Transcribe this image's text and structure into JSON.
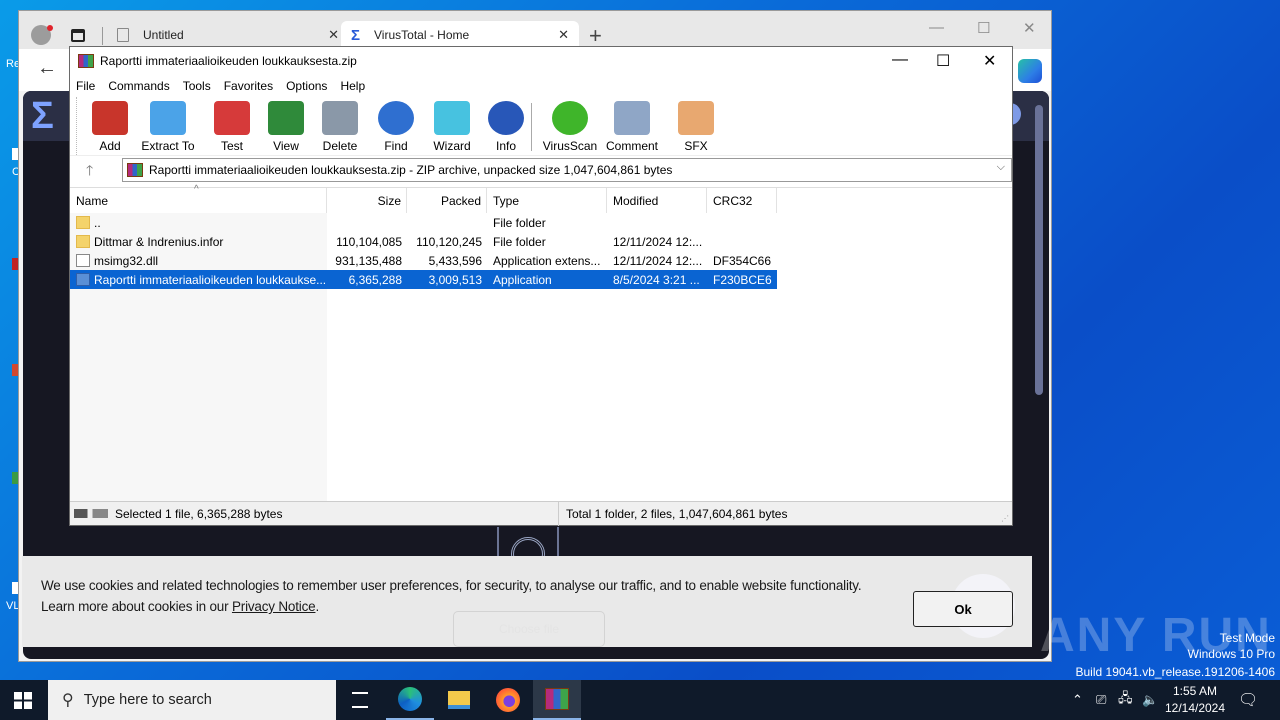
{
  "desktop": {
    "icon_labels": [
      "Re",
      "C",
      "VL"
    ]
  },
  "browser": {
    "tabs": [
      {
        "title": "Untitled",
        "icon": "page-icon",
        "active": false
      },
      {
        "title": "VirusTotal - Home",
        "icon": "virustotal-icon",
        "active": true
      }
    ],
    "new_tab": "+",
    "window_controls": {
      "minimize": "—",
      "maximize": "☐",
      "close": "✕"
    },
    "back": "←",
    "page": {
      "choose_file": "Choose file",
      "cookie_banner": {
        "text_1": "We use cookies and related technologies to remember user preferences, for security, to analyse our traffic, and to enable website functionality.",
        "text_2": "Learn more about cookies in our ",
        "link": "Privacy Notice",
        "text_3": ".",
        "ok_button": "Ok"
      }
    }
  },
  "winrar": {
    "title": "Raportti immateriaalioikeuden loukkauksesta.zip",
    "window_controls": {
      "minimize": "—",
      "maximize": "☐",
      "close": "✕"
    },
    "menu": [
      "File",
      "Commands",
      "Tools",
      "Favorites",
      "Options",
      "Help"
    ],
    "toolbar": [
      {
        "label": "Add",
        "icon": "add-archive-icon",
        "color": "#c8352b"
      },
      {
        "label": "Extract To",
        "icon": "extract-folder-icon",
        "color": "#4ba3e8"
      },
      {
        "label": "Test",
        "icon": "test-clipboard-icon",
        "color": "#d63a3a"
      },
      {
        "label": "View",
        "icon": "view-book-icon",
        "color": "#2f8a3a"
      },
      {
        "label": "Delete",
        "icon": "delete-trash-icon",
        "color": "#8a98a8"
      },
      {
        "label": "Find",
        "icon": "find-magnifier-icon",
        "color": "#2f6fd0"
      },
      {
        "label": "Wizard",
        "icon": "wizard-wand-icon",
        "color": "#47c2e0"
      },
      {
        "label": "Info",
        "icon": "info-icon",
        "color": "#2857b8"
      },
      {
        "label": "VirusScan",
        "icon": "virusscan-icon",
        "color": "#3fb52a"
      },
      {
        "label": "Comment",
        "icon": "comment-icon",
        "color": "#8fa6c6"
      },
      {
        "label": "SFX",
        "icon": "sfx-box-icon",
        "color": "#e8a870"
      }
    ],
    "address": "Raportti immateriaalioikeuden loukkauksesta.zip - ZIP archive, unpacked size 1,047,604,861 bytes",
    "columns": [
      "Name",
      "Size",
      "Packed",
      "Type",
      "Modified",
      "CRC32"
    ],
    "files": [
      {
        "name": "..",
        "size": "",
        "packed": "",
        "type": "File folder",
        "modified": "",
        "crc": "",
        "icon": "folder",
        "selected": false
      },
      {
        "name": "Dittmar & Indrenius.infor",
        "size": "110,104,085",
        "packed": "110,120,245",
        "type": "File folder",
        "modified": "12/11/2024 12:...",
        "crc": "",
        "icon": "folder",
        "selected": false
      },
      {
        "name": "msimg32.dll",
        "size": "931,135,488",
        "packed": "5,433,596",
        "type": "Application extens...",
        "modified": "12/11/2024 12:...",
        "crc": "DF354C66",
        "icon": "dll",
        "selected": false
      },
      {
        "name": "Raportti immateriaalioikeuden loukkaukse...",
        "size": "6,365,288",
        "packed": "3,009,513",
        "type": "Application",
        "modified": "8/5/2024 3:21 ...",
        "crc": "F230BCE6",
        "icon": "exe",
        "selected": true
      }
    ],
    "status_left": "Selected 1 file, 6,365,288 bytes",
    "status_right": "Total 1 folder, 2 files, 1,047,604,861 bytes"
  },
  "watermark": {
    "brand": "ANY RUN",
    "line1": "Test Mode",
    "line2": "Windows 10 Pro",
    "line3": "Build 19041.vb_release.191206-1406"
  },
  "taskbar": {
    "search_placeholder": "Type here to search",
    "time": "1:55 AM",
    "date": "12/14/2024"
  }
}
